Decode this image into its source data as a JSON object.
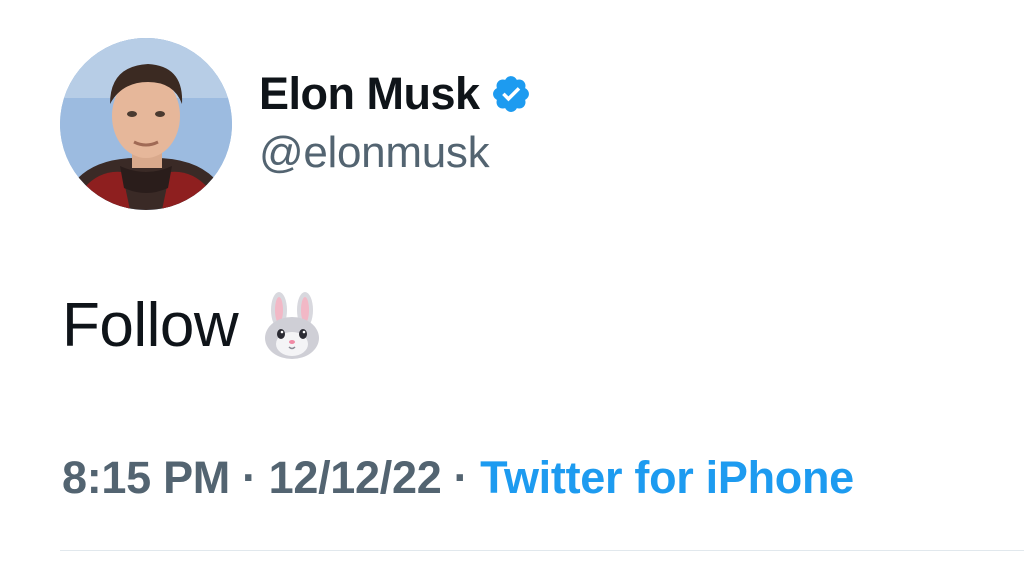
{
  "author": {
    "display_name": "Elon Musk",
    "handle": "@elonmusk",
    "verified": true,
    "avatar_icon": "profile-photo",
    "badge_color": "#1d9bf0"
  },
  "tweet": {
    "text": "Follow",
    "emoji": "rabbit-face-emoji"
  },
  "meta": {
    "time": "8:15 PM",
    "separator": "·",
    "date": "12/12/22",
    "source": "Twitter for iPhone",
    "source_color": "#1d9bf0"
  }
}
